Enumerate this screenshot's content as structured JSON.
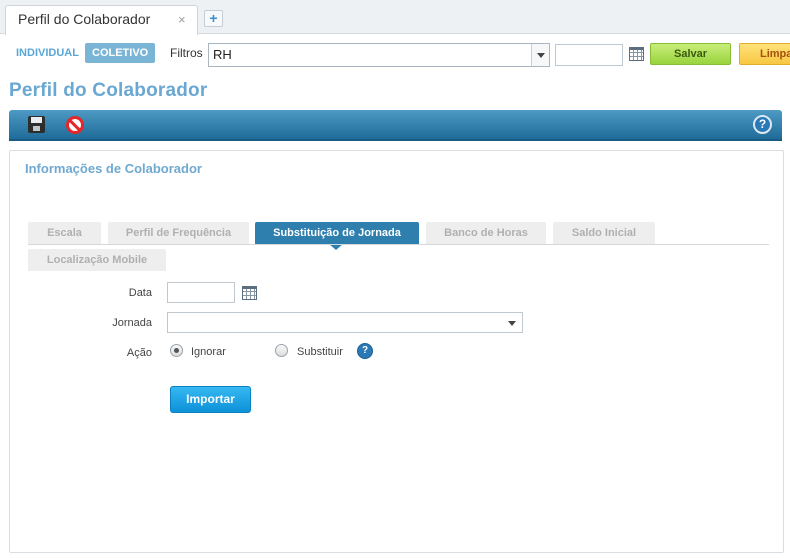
{
  "tabs": {
    "active_label": "Perfil do Colaborador",
    "close_glyph": "×",
    "new_glyph": "+"
  },
  "filter_bar": {
    "individual_label": "INDIVIDUAL",
    "coletivo_label": "COLETIVO",
    "filtros_label": "Filtros",
    "filtros_value": "RH",
    "date_value": "",
    "salvar_label": "Salvar",
    "limpar_label": "Limpa"
  },
  "page": {
    "title": "Perfil do Colaborador"
  },
  "toolbar": {
    "help_glyph": "?"
  },
  "panel": {
    "title": "Informações de Colaborador",
    "tabs": [
      {
        "label": "Escala",
        "active": false
      },
      {
        "label": "Perfil de Frequência",
        "active": false
      },
      {
        "label": "Substituição de Jornada",
        "active": true
      },
      {
        "label": "Banco de Horas",
        "active": false
      },
      {
        "label": "Saldo Inicial",
        "active": false
      },
      {
        "label": "Localização Mobile",
        "active": false
      }
    ]
  },
  "form": {
    "data_label": "Data",
    "data_value": "",
    "jornada_label": "Jornada",
    "jornada_value": "",
    "acao_label": "Ação",
    "acao_options": [
      {
        "label": "Ignorar",
        "checked": true
      },
      {
        "label": "Substituir",
        "checked": false
      }
    ],
    "help_glyph": "?",
    "importar_label": "Importar"
  },
  "colors": {
    "accent_blue": "#2f7fae",
    "title_blue": "#6aa8d3",
    "salvar_green": "#99d33d",
    "limpar_yellow": "#f8c743",
    "importar_blue": "#0d91d8"
  }
}
